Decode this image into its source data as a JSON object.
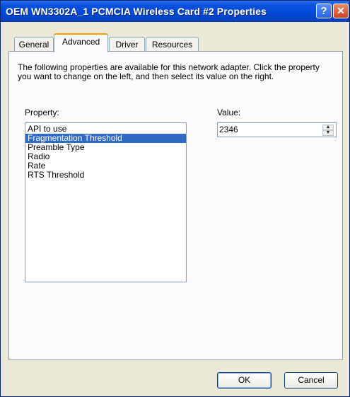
{
  "window": {
    "title": "OEM WN3302A_1 PCMCIA Wireless Card #2 Properties"
  },
  "title_buttons": {
    "help": "?",
    "close": "✕"
  },
  "tabs": [
    {
      "label": "General"
    },
    {
      "label": "Advanced",
      "active": true
    },
    {
      "label": "Driver"
    },
    {
      "label": "Resources"
    }
  ],
  "advanced": {
    "description": "The following properties are available for this network adapter. Click the property you want to change on the left, and then select its value on the right.",
    "property_label": "Property:",
    "value_label": "Value:",
    "properties": [
      {
        "label": "API to use"
      },
      {
        "label": "Fragmentation Threshold",
        "selected": true
      },
      {
        "label": "Preamble Type"
      },
      {
        "label": "Radio"
      },
      {
        "label": "Rate"
      },
      {
        "label": "RTS Threshold"
      }
    ],
    "value": "2346"
  },
  "buttons": {
    "ok": "OK",
    "cancel": "Cancel"
  },
  "colors": {
    "titlebar": "#0a52e0",
    "selection": "#316ac5",
    "active_tab_accent": "#ff9a00",
    "dialog_bg": "#ece9d8"
  }
}
